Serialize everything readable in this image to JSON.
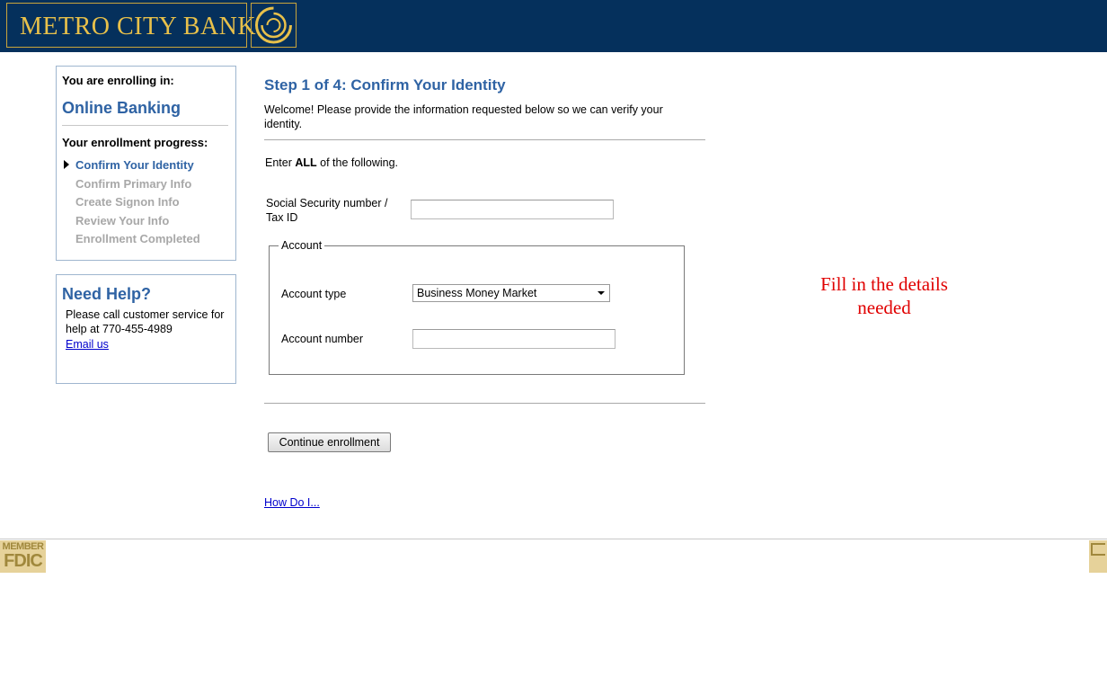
{
  "header": {
    "bank_name": "METRO CITY BANK",
    "logo_icon": "sun-swirl-logo",
    "bg_color": "#05305c",
    "gold_color": "#e8c04a"
  },
  "sidebar": {
    "enrolling_label": "You are enrolling in:",
    "product": "Online Banking",
    "progress_label": "Your enrollment progress:",
    "steps": [
      {
        "label": "Confirm Your Identity",
        "active": true
      },
      {
        "label": "Confirm Primary Info",
        "active": false
      },
      {
        "label": "Create Signon Info",
        "active": false
      },
      {
        "label": "Review Your Info",
        "active": false
      },
      {
        "label": "Enrollment Completed",
        "active": false
      }
    ],
    "help": {
      "title": "Need Help?",
      "text": "Please call customer service for help at  770-455-4989",
      "email_link": "Email us"
    }
  },
  "main": {
    "title": "Step 1 of 4: Confirm Your Identity",
    "welcome": "Welcome! Please provide the information requested below so we can verify your identity.",
    "instruction_prefix": "Enter ",
    "instruction_bold": "ALL",
    "instruction_suffix": " of the following.",
    "ssn_label": "Social Security number / Tax ID",
    "ssn_value": "",
    "account_legend": "Account",
    "account_type_label": "Account type",
    "account_type_value": "Business Money Market",
    "account_number_label": "Account number",
    "account_number_value": "",
    "continue_button": "Continue enrollment",
    "how_do_link": "How Do I..."
  },
  "annotation": {
    "line1": "Fill in the details",
    "line2": "needed",
    "color": "#e00000"
  },
  "footer": {
    "fdic_member": "MEMBER",
    "fdic_name": "FDIC",
    "equal_housing_icon": "equal-housing-lender-icon"
  }
}
